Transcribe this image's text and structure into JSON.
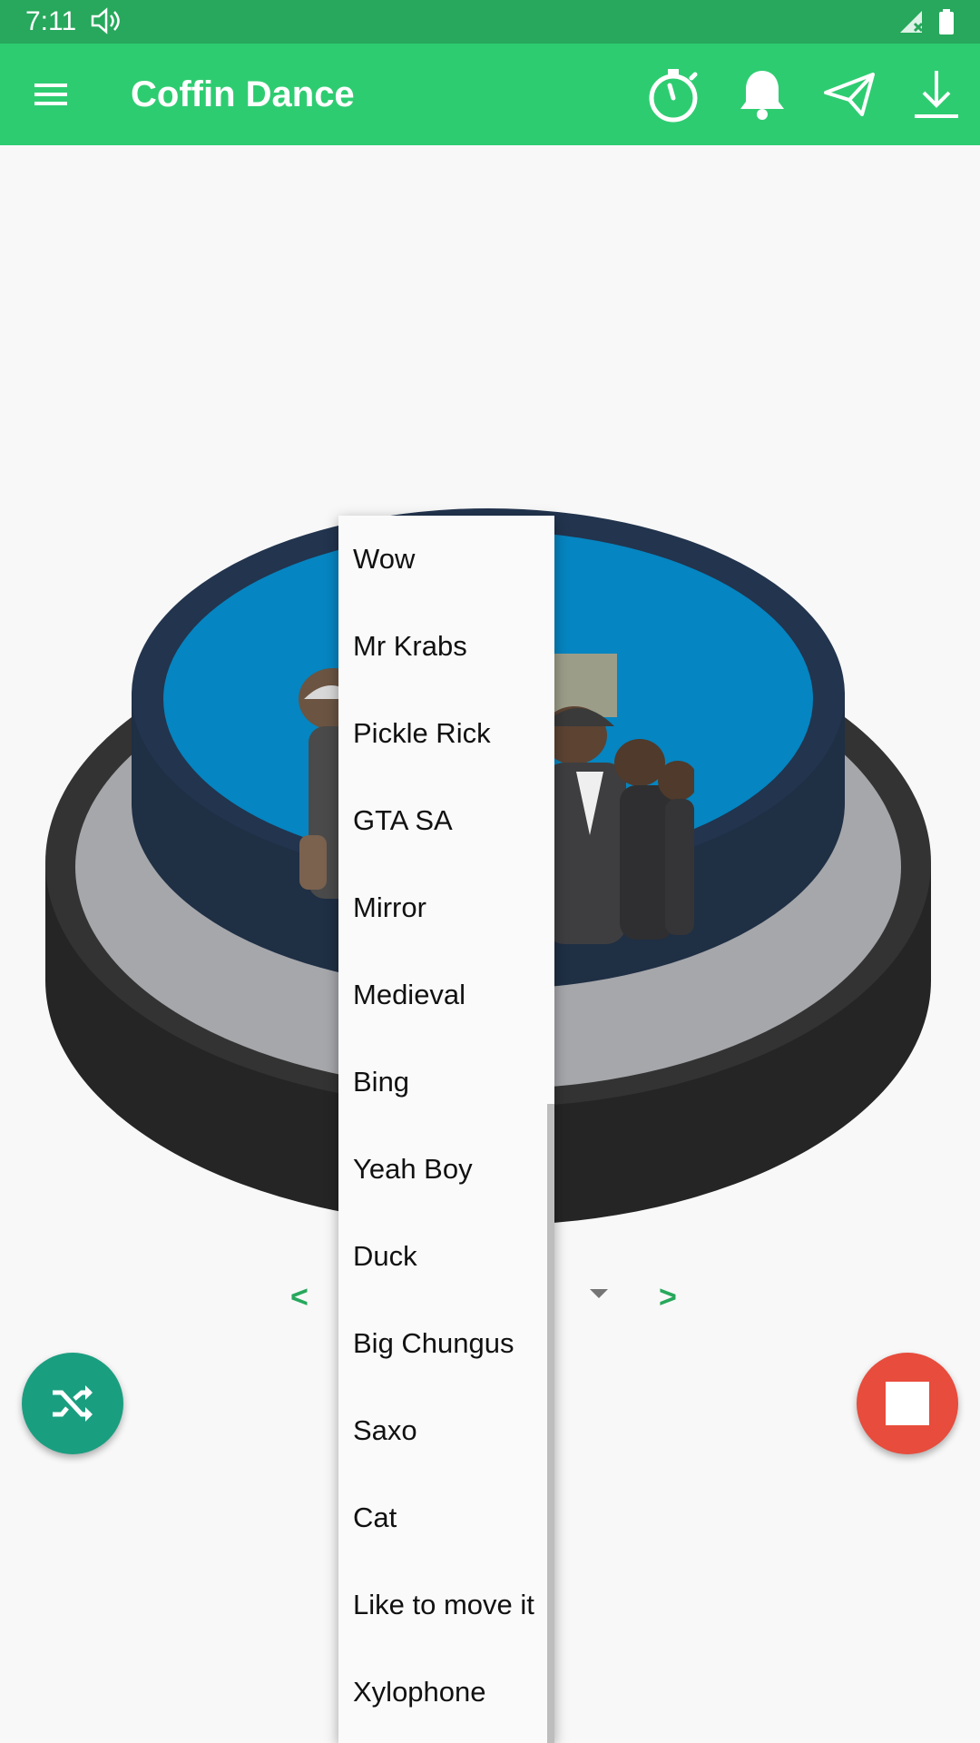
{
  "status_bar": {
    "time": "7:11",
    "volume_icon": "volume-icon",
    "signal_icon": "signal-icon",
    "battery_icon": "battery-icon"
  },
  "app_bar": {
    "title": "Coffin Dance",
    "menu_icon": "menu-icon",
    "actions": [
      "stopwatch-icon",
      "bell-icon",
      "send-icon",
      "download-icon"
    ],
    "color": "#2ecc71"
  },
  "navigator": {
    "prev_label": "<",
    "next_label": ">"
  },
  "dropdown": {
    "items": [
      "Wow",
      "Mr Krabs",
      "Pickle Rick",
      "GTA SA",
      "Mirror",
      "Medieval",
      "Bing",
      "Yeah Boy",
      "Duck",
      "Big Chungus",
      "Saxo",
      "Cat",
      "Like to move it",
      "Xylophone"
    ]
  },
  "fabs": {
    "shuffle_icon": "shuffle-icon",
    "stop_icon": "stop-icon",
    "shuffle_color": "#1a9e80",
    "stop_color": "#e74c3c"
  }
}
